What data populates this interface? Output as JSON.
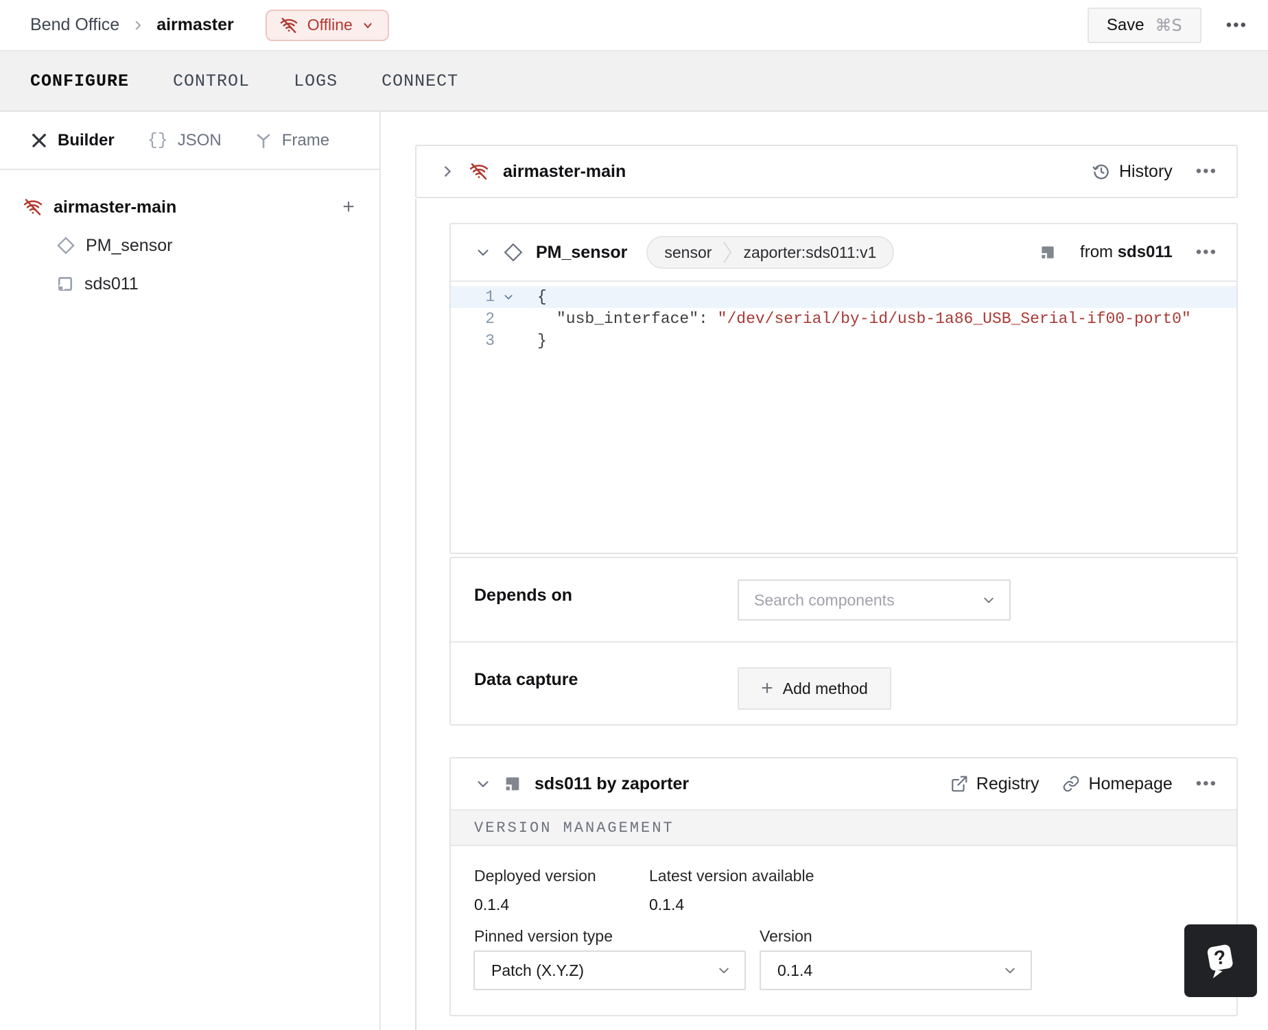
{
  "colors": {
    "status_red": "#b0392f",
    "status_bg": "#fbeeed",
    "code_string_red": "#a83a35",
    "active_line_blue": "#edf4fc",
    "band_gray": "#f1f1f2"
  },
  "header": {
    "breadcrumb_org": "Bend Office",
    "breadcrumb_machine": "airmaster",
    "status_label": "Offline",
    "save_label": "Save",
    "save_shortcut": "⌘S"
  },
  "tabs": {
    "configure": "CONFIGURE",
    "control": "CONTROL",
    "logs": "LOGS",
    "connect": "CONNECT"
  },
  "sidebar": {
    "modes": {
      "builder": "Builder",
      "json": "JSON",
      "frame": "Frame"
    },
    "tree": {
      "machine": "airmaster-main",
      "component": "PM_sensor",
      "module": "sds011"
    }
  },
  "main": {
    "machine_card": {
      "title": "airmaster-main",
      "history_label": "History"
    },
    "component_card": {
      "title": "PM_sensor",
      "type_badge": "sensor",
      "model_badge": "zaporter:sds011:v1",
      "from_label": "from",
      "from_module": "sds011",
      "code": {
        "lines": {
          "l1": {
            "n": "1",
            "text": "{"
          },
          "l2": {
            "n": "2",
            "key": "\"usb_interface\":",
            "value": "\"/dev/serial/by-id/usb-1a86_USB_Serial-if00-port0\""
          },
          "l3": {
            "n": "3",
            "text": "}"
          }
        }
      },
      "depends_on": {
        "label": "Depends on",
        "placeholder": "Search components"
      },
      "data_capture": {
        "label": "Data capture",
        "add_label": "Add method"
      }
    },
    "module_card": {
      "title": "sds011 by zaporter",
      "registry_label": "Registry",
      "homepage_label": "Homepage",
      "section_title": "VERSION MANAGEMENT",
      "deployed_label": "Deployed version",
      "deployed_value": "0.1.4",
      "latest_label": "Latest version available",
      "latest_value": "0.1.4",
      "pinned_label": "Pinned version type",
      "pinned_value": "Patch (X.Y.Z)",
      "version_label": "Version",
      "version_value": "0.1.4"
    }
  }
}
